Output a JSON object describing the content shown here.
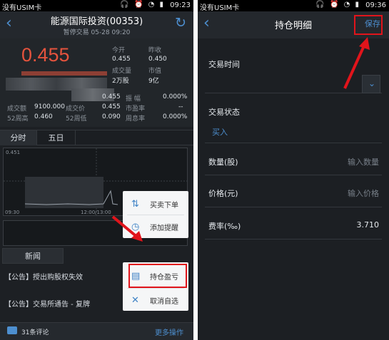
{
  "left_screen": {
    "status": {
      "carrier": "没有USIM卡",
      "time": "09:23"
    },
    "header": {
      "title": "能源国际投资(00353)",
      "subtitle": "暂停交易 05-28 09:20"
    },
    "quote": {
      "price": "0.455",
      "open_label": "今开",
      "open_value": "0.455",
      "prev_close_label": "昨收",
      "prev_close_value": "0.450",
      "volume_label": "成交量",
      "volume_value": "2万股",
      "market_cap_label": "市值",
      "market_cap_value": "9亿",
      "row3_value": "0.455",
      "amplitude_label": "振 幅",
      "amplitude_value": "0.000%",
      "turnover_label": "成交额",
      "turnover_value": "9100.000",
      "avg_price_label": "成交价",
      "avg_price_value": "0.455",
      "pe_label": "市盈率",
      "pe_value": "--",
      "high52_label": "52周高",
      "high52_value": "0.460",
      "low52_label": "52周低",
      "low52_value": "0.090",
      "turnover_rate_label": "周息率",
      "turnover_rate_value": "0.000%"
    },
    "tabs": [
      "分时",
      "五日"
    ],
    "chart": {
      "top_price": "0.451",
      "time_start": "09:30",
      "time_mid": "12:00/13:00"
    },
    "news_tab": "新闻",
    "news": [
      "【公告】授出购股权失效",
      "【公告】交易所通告 - 复牌"
    ],
    "popup": {
      "item1": "买卖下单",
      "item2": "添加提醒",
      "item3": "持仓盈亏",
      "item4": "取消自选"
    },
    "bottom": {
      "comments": "31条评论",
      "more": "更多操作"
    }
  },
  "right_screen": {
    "status": {
      "carrier": "没有USIM卡",
      "time": "09:36"
    },
    "header": {
      "title": "持仓明细",
      "save": "保存"
    },
    "trade_time_label": "交易时间",
    "trade_status_label": "交易状态",
    "trade_status_value": "买入",
    "quantity_label": "数量(股)",
    "quantity_placeholder": "输入数量",
    "price_label": "价格(元)",
    "price_placeholder": "输入价格",
    "fee_label": "费率(‰)",
    "fee_value": "3.710"
  },
  "colors": {
    "accent": "#4d8fd0",
    "price_red": "#e5533d",
    "annotation_red": "#e1141b"
  }
}
